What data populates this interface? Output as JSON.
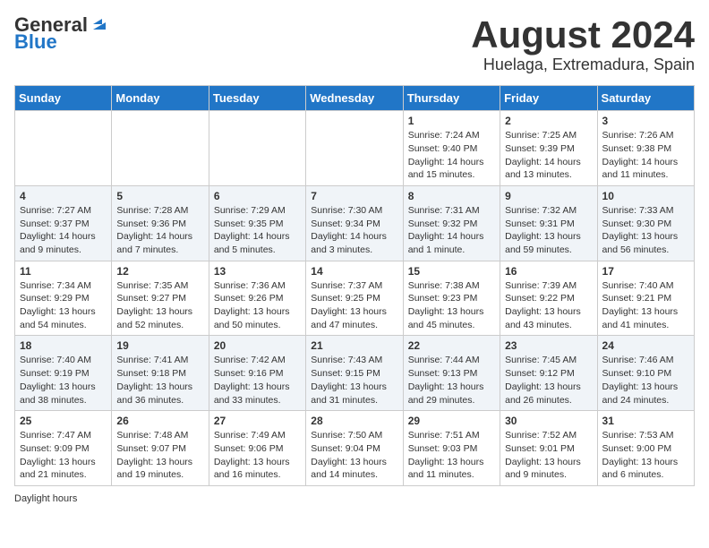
{
  "logo": {
    "line1": "General",
    "line2": "Blue"
  },
  "title": "August 2024",
  "subtitle": "Huelaga, Extremadura, Spain",
  "days_of_week": [
    "Sunday",
    "Monday",
    "Tuesday",
    "Wednesday",
    "Thursday",
    "Friday",
    "Saturday"
  ],
  "weeks": [
    [
      {
        "num": "",
        "info": ""
      },
      {
        "num": "",
        "info": ""
      },
      {
        "num": "",
        "info": ""
      },
      {
        "num": "",
        "info": ""
      },
      {
        "num": "1",
        "info": "Sunrise: 7:24 AM\nSunset: 9:40 PM\nDaylight: 14 hours and 15 minutes."
      },
      {
        "num": "2",
        "info": "Sunrise: 7:25 AM\nSunset: 9:39 PM\nDaylight: 14 hours and 13 minutes."
      },
      {
        "num": "3",
        "info": "Sunrise: 7:26 AM\nSunset: 9:38 PM\nDaylight: 14 hours and 11 minutes."
      }
    ],
    [
      {
        "num": "4",
        "info": "Sunrise: 7:27 AM\nSunset: 9:37 PM\nDaylight: 14 hours and 9 minutes."
      },
      {
        "num": "5",
        "info": "Sunrise: 7:28 AM\nSunset: 9:36 PM\nDaylight: 14 hours and 7 minutes."
      },
      {
        "num": "6",
        "info": "Sunrise: 7:29 AM\nSunset: 9:35 PM\nDaylight: 14 hours and 5 minutes."
      },
      {
        "num": "7",
        "info": "Sunrise: 7:30 AM\nSunset: 9:34 PM\nDaylight: 14 hours and 3 minutes."
      },
      {
        "num": "8",
        "info": "Sunrise: 7:31 AM\nSunset: 9:32 PM\nDaylight: 14 hours and 1 minute."
      },
      {
        "num": "9",
        "info": "Sunrise: 7:32 AM\nSunset: 9:31 PM\nDaylight: 13 hours and 59 minutes."
      },
      {
        "num": "10",
        "info": "Sunrise: 7:33 AM\nSunset: 9:30 PM\nDaylight: 13 hours and 56 minutes."
      }
    ],
    [
      {
        "num": "11",
        "info": "Sunrise: 7:34 AM\nSunset: 9:29 PM\nDaylight: 13 hours and 54 minutes."
      },
      {
        "num": "12",
        "info": "Sunrise: 7:35 AM\nSunset: 9:27 PM\nDaylight: 13 hours and 52 minutes."
      },
      {
        "num": "13",
        "info": "Sunrise: 7:36 AM\nSunset: 9:26 PM\nDaylight: 13 hours and 50 minutes."
      },
      {
        "num": "14",
        "info": "Sunrise: 7:37 AM\nSunset: 9:25 PM\nDaylight: 13 hours and 47 minutes."
      },
      {
        "num": "15",
        "info": "Sunrise: 7:38 AM\nSunset: 9:23 PM\nDaylight: 13 hours and 45 minutes."
      },
      {
        "num": "16",
        "info": "Sunrise: 7:39 AM\nSunset: 9:22 PM\nDaylight: 13 hours and 43 minutes."
      },
      {
        "num": "17",
        "info": "Sunrise: 7:40 AM\nSunset: 9:21 PM\nDaylight: 13 hours and 41 minutes."
      }
    ],
    [
      {
        "num": "18",
        "info": "Sunrise: 7:40 AM\nSunset: 9:19 PM\nDaylight: 13 hours and 38 minutes."
      },
      {
        "num": "19",
        "info": "Sunrise: 7:41 AM\nSunset: 9:18 PM\nDaylight: 13 hours and 36 minutes."
      },
      {
        "num": "20",
        "info": "Sunrise: 7:42 AM\nSunset: 9:16 PM\nDaylight: 13 hours and 33 minutes."
      },
      {
        "num": "21",
        "info": "Sunrise: 7:43 AM\nSunset: 9:15 PM\nDaylight: 13 hours and 31 minutes."
      },
      {
        "num": "22",
        "info": "Sunrise: 7:44 AM\nSunset: 9:13 PM\nDaylight: 13 hours and 29 minutes."
      },
      {
        "num": "23",
        "info": "Sunrise: 7:45 AM\nSunset: 9:12 PM\nDaylight: 13 hours and 26 minutes."
      },
      {
        "num": "24",
        "info": "Sunrise: 7:46 AM\nSunset: 9:10 PM\nDaylight: 13 hours and 24 minutes."
      }
    ],
    [
      {
        "num": "25",
        "info": "Sunrise: 7:47 AM\nSunset: 9:09 PM\nDaylight: 13 hours and 21 minutes."
      },
      {
        "num": "26",
        "info": "Sunrise: 7:48 AM\nSunset: 9:07 PM\nDaylight: 13 hours and 19 minutes."
      },
      {
        "num": "27",
        "info": "Sunrise: 7:49 AM\nSunset: 9:06 PM\nDaylight: 13 hours and 16 minutes."
      },
      {
        "num": "28",
        "info": "Sunrise: 7:50 AM\nSunset: 9:04 PM\nDaylight: 13 hours and 14 minutes."
      },
      {
        "num": "29",
        "info": "Sunrise: 7:51 AM\nSunset: 9:03 PM\nDaylight: 13 hours and 11 minutes."
      },
      {
        "num": "30",
        "info": "Sunrise: 7:52 AM\nSunset: 9:01 PM\nDaylight: 13 hours and 9 minutes."
      },
      {
        "num": "31",
        "info": "Sunrise: 7:53 AM\nSunset: 9:00 PM\nDaylight: 13 hours and 6 minutes."
      }
    ]
  ],
  "footer": "Daylight hours"
}
